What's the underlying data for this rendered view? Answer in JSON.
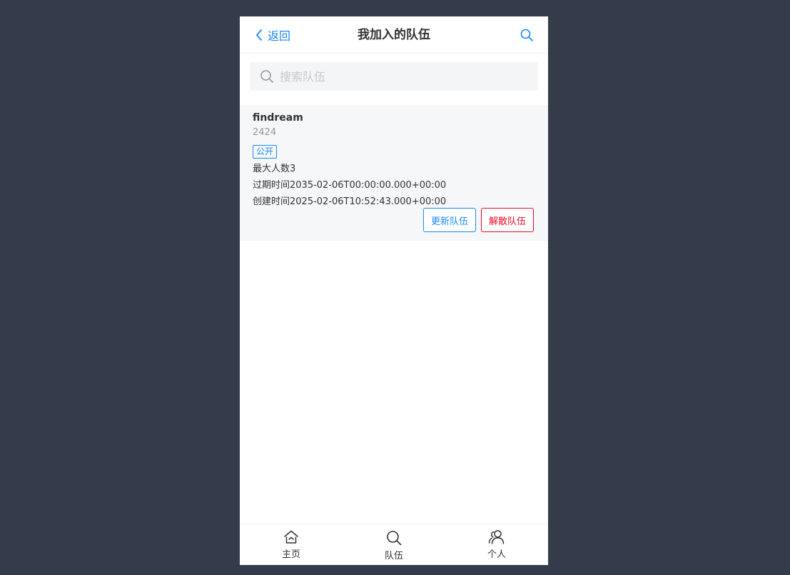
{
  "nav": {
    "back_label": "返回",
    "title": "我加入的队伍"
  },
  "search": {
    "placeholder": "搜索队伍"
  },
  "teams": [
    {
      "name": "findream",
      "description": "2424",
      "status_tag": "公开",
      "max_members_line": "最大人数3",
      "expire_line": "过期时间2035-02-06T00:00:00.000+00:00",
      "created_line": "创建时间2025-02-06T10:52:43.000+00:00",
      "update_button": "更新队伍",
      "dismiss_button": "解散队伍"
    }
  ],
  "tabbar": {
    "items": [
      {
        "label": "主页",
        "icon": "home-icon"
      },
      {
        "label": "队伍",
        "icon": "search-icon"
      },
      {
        "label": "个人",
        "icon": "user-icon"
      }
    ]
  },
  "colors": {
    "background": "#343c4c",
    "accent": "#1989fa",
    "danger": "#ee0a24",
    "card_background": "#f6f7f9",
    "muted_text": "#969799"
  }
}
